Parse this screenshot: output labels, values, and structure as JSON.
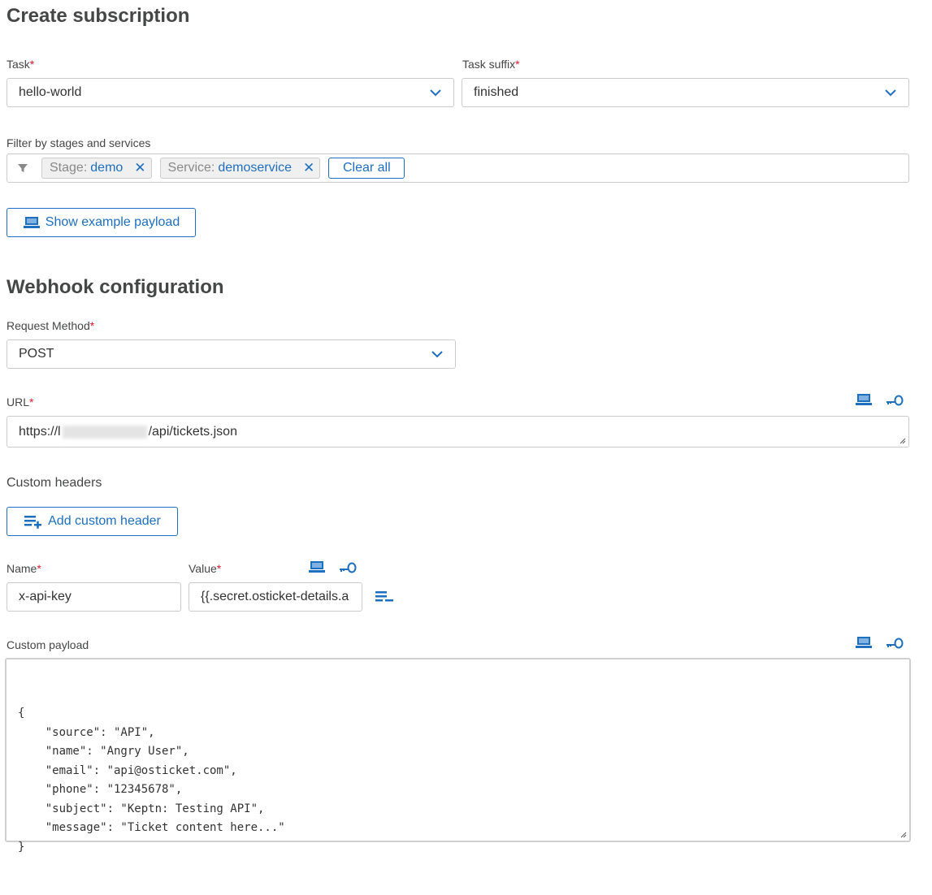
{
  "page": {
    "title": "Create subscription",
    "webhook_title": "Webhook configuration"
  },
  "task": {
    "label": "Task",
    "required_mark": "*",
    "value": "hello-world"
  },
  "task_suffix": {
    "label": "Task suffix",
    "required_mark": "*",
    "value": "finished"
  },
  "filter": {
    "label": "Filter by stages and services",
    "tags": [
      {
        "key": "Stage:",
        "value": "demo"
      },
      {
        "key": "Service:",
        "value": "demoservice"
      }
    ],
    "clear_all_label": "Clear all"
  },
  "show_payload_button": {
    "label": "Show example payload"
  },
  "request_method": {
    "label": "Request Method",
    "required_mark": "*",
    "value": "POST"
  },
  "url": {
    "label": "URL",
    "required_mark": "*",
    "prefix": "https://l",
    "suffix": "/api/tickets.json"
  },
  "custom_headers": {
    "title": "Custom headers",
    "add_label": "Add custom header",
    "name_label": "Name",
    "value_label": "Value",
    "required_mark": "*",
    "name_value": "x-api-key",
    "value_value": "{{.secret.osticket-details.a"
  },
  "custom_payload": {
    "label": "Custom payload",
    "content": "{\n    \"source\": \"API\",\n    \"name\": \"Angry User\",\n    \"email\": \"api@osticket.com\",\n    \"phone\": \"12345678\",\n    \"subject\": \"Keptn: Testing API\",\n    \"message\": \"Ticket content here...\"\n}"
  },
  "icons": {
    "select_chevron": "chevron-down-icon",
    "filter": "filter-icon",
    "remove_tag": "close-icon",
    "payload": "laptop-icon",
    "secret": "key-icon",
    "add_header": "list-add-icon",
    "remove_header": "list-remove-icon"
  },
  "colors": {
    "accent": "#1e6fbd",
    "required": "#dc172a",
    "text": "#454646"
  }
}
